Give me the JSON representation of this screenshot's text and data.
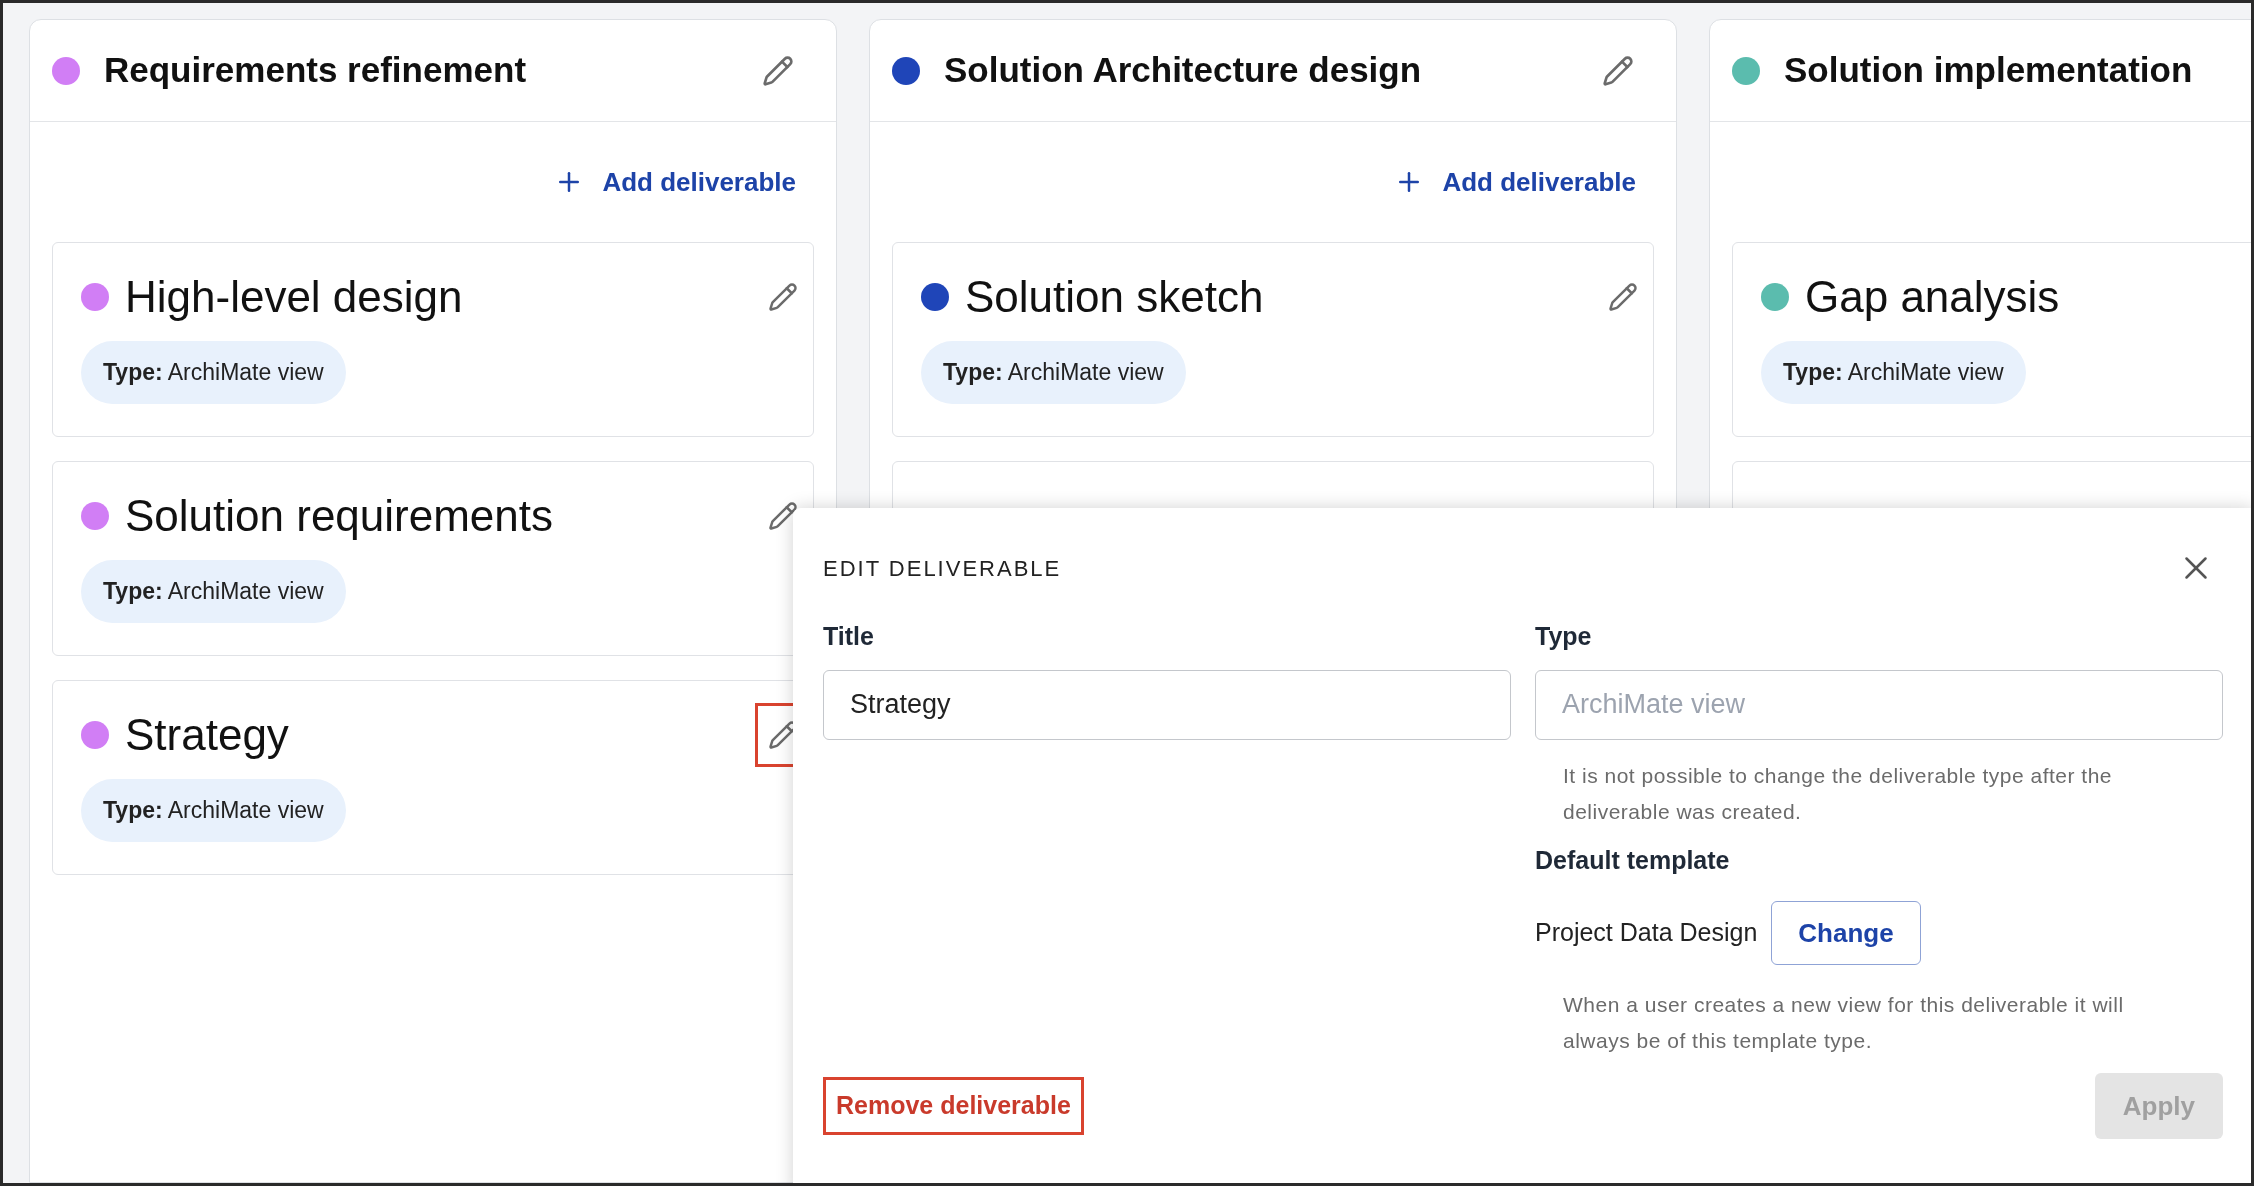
{
  "columns": [
    {
      "title": "Requirements refinement",
      "color": "#d17ef5",
      "add_label": "Add deliverable",
      "deliverables": [
        {
          "kind": "card",
          "title": "High-level design",
          "type": "**Type:** ArchiMate view",
          "highlighted": false
        },
        {
          "kind": "card",
          "title": "Solution requirements",
          "type": "**Type:** ArchiMate view",
          "highlighted": false
        },
        {
          "kind": "card",
          "title": "Strategy",
          "type": "**Type:** ArchiMate view",
          "highlighted": true
        }
      ]
    },
    {
      "title": "Solution Architecture design",
      "color": "#1f45b8",
      "add_label": "Add deliverable",
      "deliverables": [
        {
          "kind": "card",
          "title": "Solution sketch",
          "type": "**Type:** ArchiMate view",
          "highlighted": false
        },
        {
          "kind": "covered"
        }
      ]
    },
    {
      "title": "Solution implementation",
      "color": "#5bbcae",
      "deliverables": [
        {
          "kind": "card",
          "title": "Gap analysis",
          "type": "**Type:** ArchiMate view"
        },
        {
          "kind": "covered"
        }
      ]
    }
  ],
  "dialog": {
    "heading": "EDIT DELIVERABLE",
    "title_field": {
      "label": "Title",
      "value": "Strategy",
      "disabled": false
    },
    "type_field": {
      "label": "Type",
      "value": "ArchiMate view",
      "disabled": true
    },
    "type_note": "It is not possible to change the deliverable type after the deliverable was created.",
    "template_label": "Default template",
    "template_value": "Project Data Design",
    "change_button": "Change",
    "template_note": "When a user creates a new view for this deliverable it will always be of this template type.",
    "remove_button": {
      "label": "Remove deliverable",
      "highlighted": true
    },
    "apply_button": {
      "label": "Apply",
      "disabled": true
    }
  }
}
